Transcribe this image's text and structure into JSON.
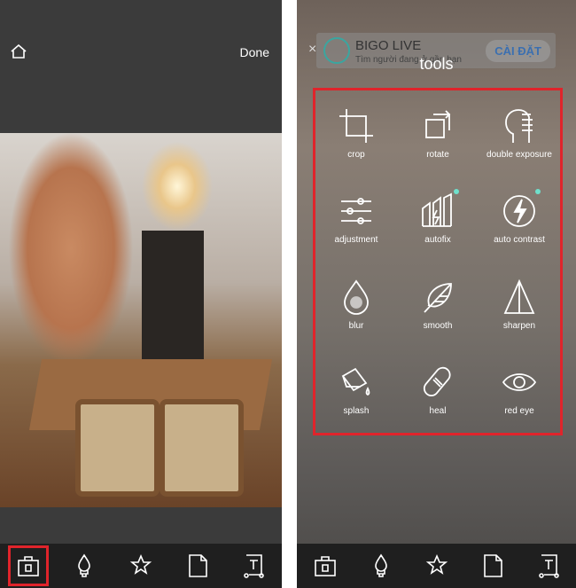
{
  "left": {
    "done_label": "Done",
    "home_icon": "home-icon"
  },
  "right": {
    "ad": {
      "title": "BIGO LIVE",
      "subtitle": "Tìm người đang ở gần bạn",
      "button": "CÀI ĐẶT"
    },
    "title": "tools",
    "tools": [
      {
        "label": "crop",
        "icon": "crop-icon"
      },
      {
        "label": "rotate",
        "icon": "rotate-icon"
      },
      {
        "label": "double exposure",
        "icon": "double-exposure-icon"
      },
      {
        "label": "adjustment",
        "icon": "sliders-icon"
      },
      {
        "label": "autofix",
        "icon": "autofix-icon",
        "new": true
      },
      {
        "label": "auto contrast",
        "icon": "auto-contrast-icon",
        "new": true
      },
      {
        "label": "blur",
        "icon": "blur-drop-icon"
      },
      {
        "label": "smooth",
        "icon": "feather-icon"
      },
      {
        "label": "sharpen",
        "icon": "triangle-icon"
      },
      {
        "label": "splash",
        "icon": "paint-bucket-icon"
      },
      {
        "label": "heal",
        "icon": "bandage-icon"
      },
      {
        "label": "red eye",
        "icon": "eye-icon"
      }
    ]
  },
  "bottom_tabs": [
    "tools-icon",
    "brush-icon",
    "effects-star-icon",
    "sticker-page-icon",
    "text-icon"
  ],
  "colors": {
    "highlight": "#e0242b",
    "accent": "#6fe0cc"
  }
}
